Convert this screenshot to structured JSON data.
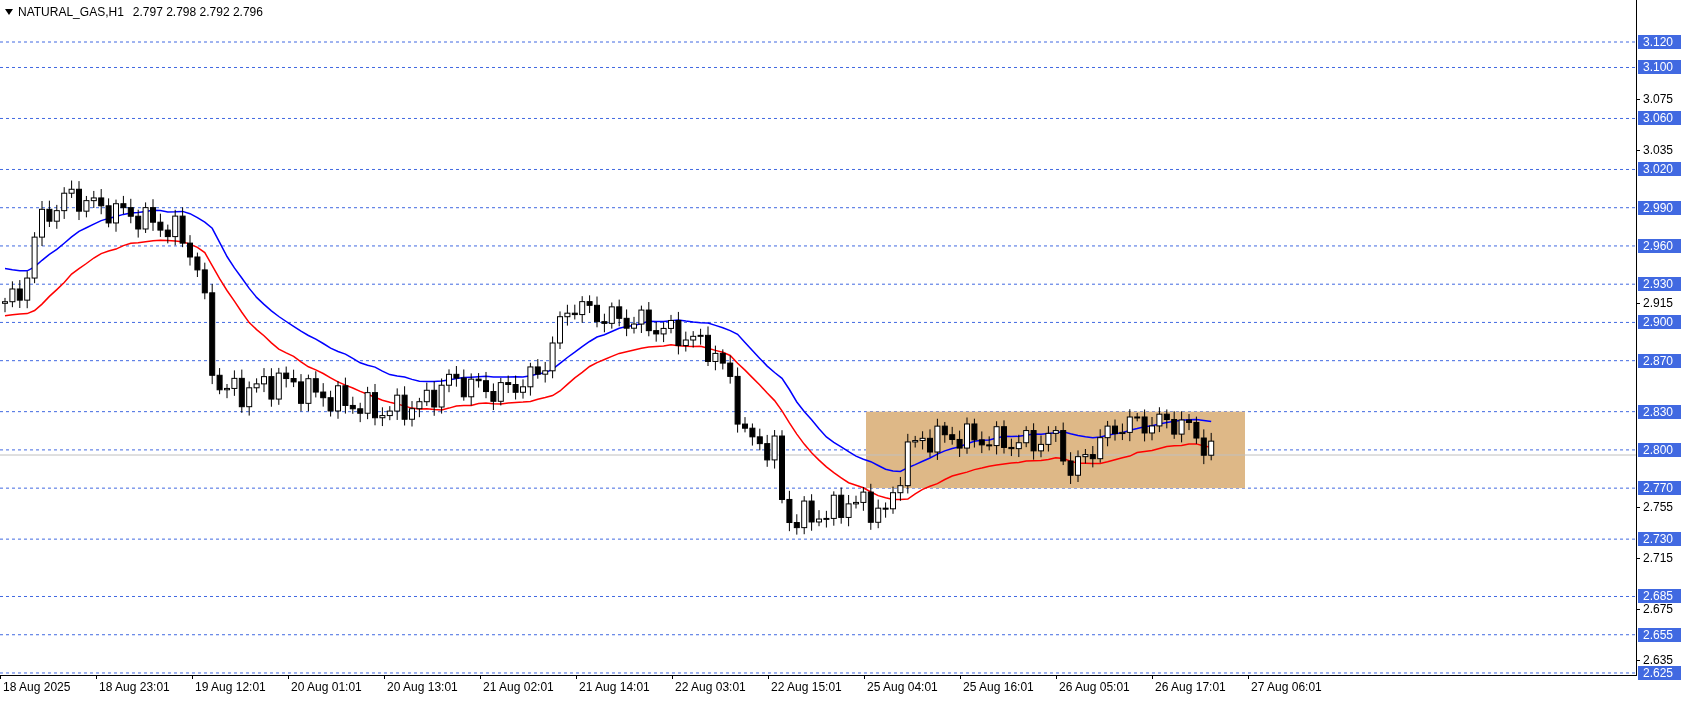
{
  "header": {
    "symbol": "NATURAL_GAS,H1",
    "quotes": "2.797 2.798 2.792 2.796"
  },
  "price_levels": [
    {
      "label": "3.120"
    },
    {
      "label": "3.100"
    },
    {
      "label": "3.060"
    },
    {
      "label": "3.020"
    },
    {
      "label": "2.990"
    },
    {
      "label": "2.960"
    },
    {
      "label": "2.930"
    },
    {
      "label": "2.900"
    },
    {
      "label": "2.870"
    },
    {
      "label": "2.830"
    },
    {
      "label": "2.800"
    },
    {
      "label": "2.770"
    },
    {
      "label": "2.730"
    },
    {
      "label": "2.685"
    },
    {
      "label": "2.655"
    },
    {
      "label": "2.625"
    }
  ],
  "price_scale": [
    "3.075",
    "3.035",
    "2.915",
    "2.755",
    "2.715",
    "2.675",
    "2.635"
  ],
  "time_scale": [
    "18 Aug 2025",
    "18 Aug 23:01",
    "19 Aug 12:01",
    "20 Aug 01:01",
    "20 Aug 13:01",
    "21 Aug 02:01",
    "21 Aug 14:01",
    "22 Aug 03:01",
    "22 Aug 15:01",
    "25 Aug 04:01",
    "25 Aug 16:01",
    "26 Aug 05:01",
    "26 Aug 17:01",
    "27 Aug 06:01"
  ]
}
